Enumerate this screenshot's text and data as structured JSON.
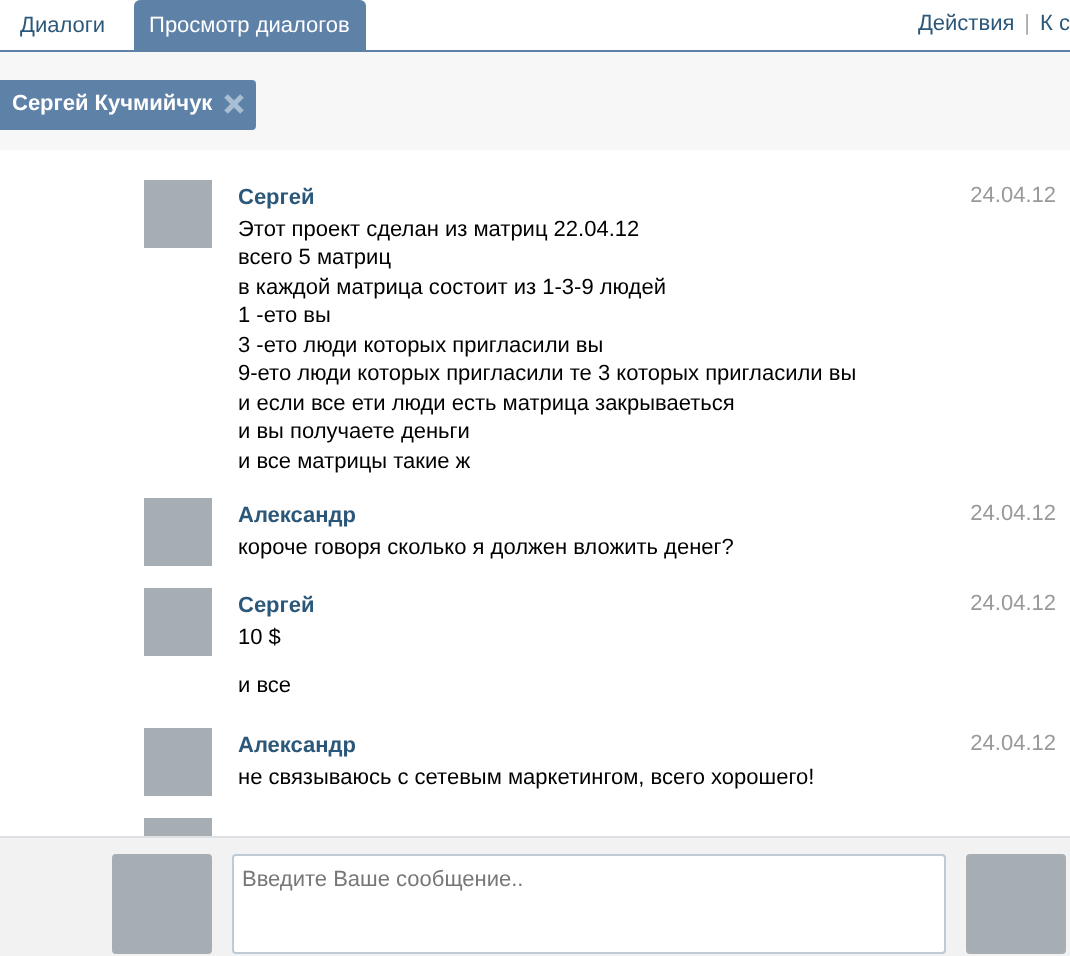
{
  "tabs": [
    {
      "label": "Диалоги",
      "selected": false
    },
    {
      "label": "Просмотр диалогов",
      "selected": true
    }
  ],
  "actions": [
    "Действия",
    "К с"
  ],
  "action_separator": "|",
  "recipient": {
    "name": "Сергей Кучмийчук"
  },
  "messages": [
    {
      "kind": "message",
      "author": "Сергей",
      "date": "24.04.12",
      "lines": [
        "Этот проект сделан из матриц 22.04.12",
        "всего 5 матриц",
        "в каждой матрица состоит из 1-3-9 людей",
        "1 -ето вы",
        "3 -ето люди которых пригласили вы",
        "9-ето люди которых пригласили те 3 которых пригласили вы",
        "и если все ети люди есть матрица закрываеться",
        "и вы получаете деньги",
        "и все матрицы такие ж"
      ]
    },
    {
      "kind": "message",
      "author": "Александр",
      "date": "24.04.12",
      "lines": [
        "короче говоря сколько я должен вложить денег?"
      ]
    },
    {
      "kind": "message",
      "author": "Сергей",
      "date": "24.04.12",
      "lines": [
        "10 $"
      ]
    },
    {
      "kind": "continuation",
      "lines": [
        "и все"
      ]
    },
    {
      "kind": "message",
      "author": "Александр",
      "date": "24.04.12",
      "lines": [
        "не связываюсь с сетевым маркетингом, всего хорошего!"
      ]
    },
    {
      "kind": "partial"
    }
  ],
  "composer": {
    "placeholder": "Введите Ваше сообщение.."
  }
}
